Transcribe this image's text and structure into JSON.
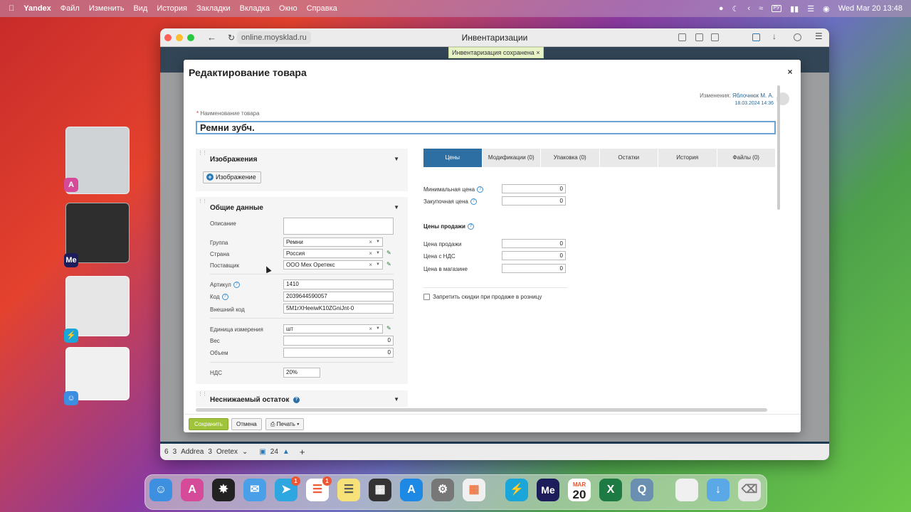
{
  "menubar": {
    "app": "Yandex",
    "items": [
      "Файл",
      "Изменить",
      "Вид",
      "История",
      "Закладки",
      "Вкладка",
      "Окно",
      "Справка"
    ],
    "input_source": "РУ",
    "clock": "Wed Mar 20  13:48"
  },
  "browser": {
    "url": "online.moysklad.ru",
    "tab_title": "Инвентаризации",
    "toast": "Инвентаризация сохранена",
    "bottom_tabs": {
      "t1_count": "6",
      "t2_count": "3",
      "t2_label": "Addrea",
      "t3_count": "3",
      "t3_label": "Oretex",
      "t4_count": "24"
    }
  },
  "modal": {
    "title": "Редактирование товара",
    "changed_label": "Изменения:",
    "changed_by": "Яблочнюк М. А.",
    "changed_at": "18.03.2024 14:36",
    "name_label": "Наименование товара",
    "name_value": "Ремни зубч.",
    "images": {
      "header": "Изображения",
      "add_button": "Изображение"
    },
    "general": {
      "header": "Общие данные",
      "description_label": "Описание",
      "group_label": "Группа",
      "group_value": "Ремни",
      "country_label": "Страна",
      "country_value": "Россия",
      "supplier_label": "Поставщик",
      "supplier_value": "ООО Мех Оретекс",
      "article_label": "Артикул",
      "article_value": "1410",
      "code_label": "Код",
      "code_value": "2039644590057",
      "ext_code_label": "Внешний код",
      "ext_code_value": "5M1rXHeeiwK10ZGniJnt-0",
      "unit_label": "Единица измерения",
      "unit_value": "шт",
      "weight_label": "Вес",
      "weight_value": "0",
      "volume_label": "Объем",
      "volume_value": "0",
      "vat_label": "НДС",
      "vat_value": "20%"
    },
    "min_stock": {
      "header": "Неснижаемый остаток"
    },
    "tabs": [
      "Цены",
      "Модификации (0)",
      "Упаковка (0)",
      "Остатки",
      "История",
      "Файлы (0)"
    ],
    "prices": {
      "min_price_label": "Минимальная цена",
      "min_price_value": "0",
      "purchase_price_label": "Закупочная цена",
      "purchase_price_value": "0",
      "sale_prices_title": "Цены продажи",
      "sale_price_label": "Цена продажи",
      "sale_price_value": "0",
      "vat_price_label": "Цена с НДС",
      "vat_price_value": "0",
      "store_price_label": "Цена в магазине",
      "store_price_value": "0",
      "discount_label": "Запретить скидки при продаже в розницу"
    },
    "footer": {
      "save": "Сохранить",
      "cancel": "Отмена",
      "print": "Печать"
    }
  },
  "dock": {
    "telegram_badge": "1",
    "reminders_badge": "1",
    "calendar_month": "MAR",
    "calendar_day": "20"
  },
  "colors": {
    "accent": "#2d6fa3",
    "save_green": "#9fc33a",
    "focus_border": "#6aa3d6"
  }
}
